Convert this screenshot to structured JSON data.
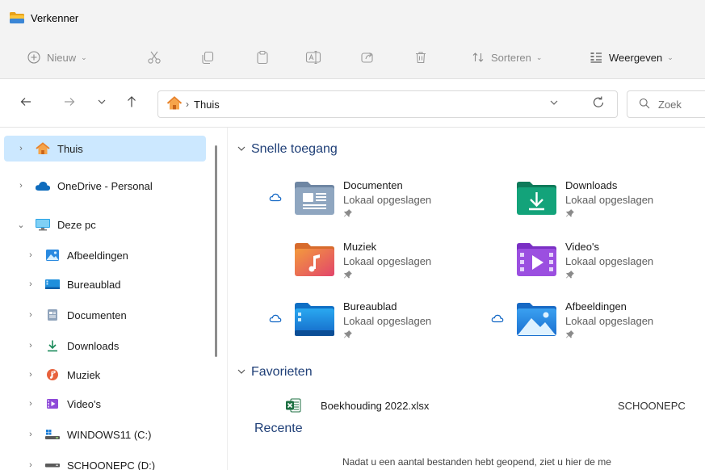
{
  "window": {
    "title": "Verkenner"
  },
  "toolbar": {
    "new_label": "Nieuw",
    "sort_label": "Sorteren",
    "view_label": "Weergeven"
  },
  "address": {
    "crumb": "Thuis",
    "search_placeholder": "Zoek"
  },
  "sidebar": {
    "items": [
      {
        "label": "Thuis",
        "icon": "home-icon",
        "selected": true
      },
      {
        "label": "OneDrive - Personal",
        "icon": "onedrive-icon"
      },
      {
        "label": "Deze pc",
        "icon": "pc-icon",
        "expanded": true
      },
      {
        "label": "Afbeeldingen",
        "icon": "pictures-icon"
      },
      {
        "label": "Bureaublad",
        "icon": "desktop-icon"
      },
      {
        "label": "Documenten",
        "icon": "documents-icon"
      },
      {
        "label": "Downloads",
        "icon": "download-icon"
      },
      {
        "label": "Muziek",
        "icon": "music-icon"
      },
      {
        "label": "Video's",
        "icon": "video-icon"
      },
      {
        "label": "WINDOWS11 (C:)",
        "icon": "drive-icon"
      },
      {
        "label": "SCHOONEPC (D:)",
        "icon": "drive-icon"
      }
    ]
  },
  "quick_access": {
    "header": "Snelle toegang",
    "tiles": [
      {
        "name": "Documenten",
        "sub": "Lokaal opgeslagen",
        "icon": "documents-folder-icon",
        "cloud": true
      },
      {
        "name": "Downloads",
        "sub": "Lokaal opgeslagen",
        "icon": "downloads-folder-icon",
        "cloud": false
      },
      {
        "name": "Muziek",
        "sub": "Lokaal opgeslagen",
        "icon": "music-folder-icon",
        "cloud": false
      },
      {
        "name": "Video's",
        "sub": "Lokaal opgeslagen",
        "icon": "videos-folder-icon",
        "cloud": false
      },
      {
        "name": "Bureaublad",
        "sub": "Lokaal opgeslagen",
        "icon": "desktop-folder-icon",
        "cloud": true
      },
      {
        "name": "Afbeeldingen",
        "sub": "Lokaal opgeslagen",
        "icon": "pictures-folder-icon",
        "cloud": true
      }
    ]
  },
  "favorites": {
    "header": "Favorieten",
    "items": [
      {
        "name": "Boekhouding 2022.xlsx",
        "location": "SCHOONEPC",
        "icon": "excel-icon"
      }
    ]
  },
  "recent": {
    "header": "Recente",
    "empty_message": "Nadat u een aantal bestanden hebt geopend, ziet u hier de me"
  },
  "colors": {
    "accent": "#0067c0",
    "selection": "#cce8ff",
    "group_header": "#1f3f77",
    "chrome": "#f3f3f3"
  }
}
